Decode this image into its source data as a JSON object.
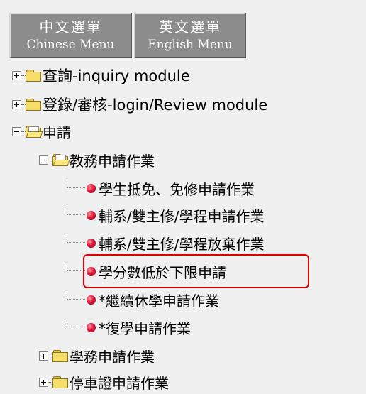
{
  "menu_tabs": [
    {
      "zh": "中文選單",
      "en": "Chinese Menu"
    },
    {
      "zh": "英文選單",
      "en": "English Menu"
    }
  ],
  "tree": {
    "inquiry": "查詢-inquiry module",
    "login_review": "登錄/審核-login/Review module",
    "apply": "申請",
    "academic_affairs": "教務申請作業",
    "items": [
      "學生抵免、免修申請作業",
      "輔系/雙主修/學程申請作業",
      "輔系/雙主修/學程放棄作業",
      "學分數低於下限申請",
      "*繼續休學申請作業",
      "*復學申請作業"
    ],
    "student_affairs": "學務申請作業",
    "parking": "停車證申請作業"
  },
  "colors": {
    "highlight": "#e00000",
    "tab_bg": "#8c8c8c",
    "bullet": "#e0163a"
  }
}
